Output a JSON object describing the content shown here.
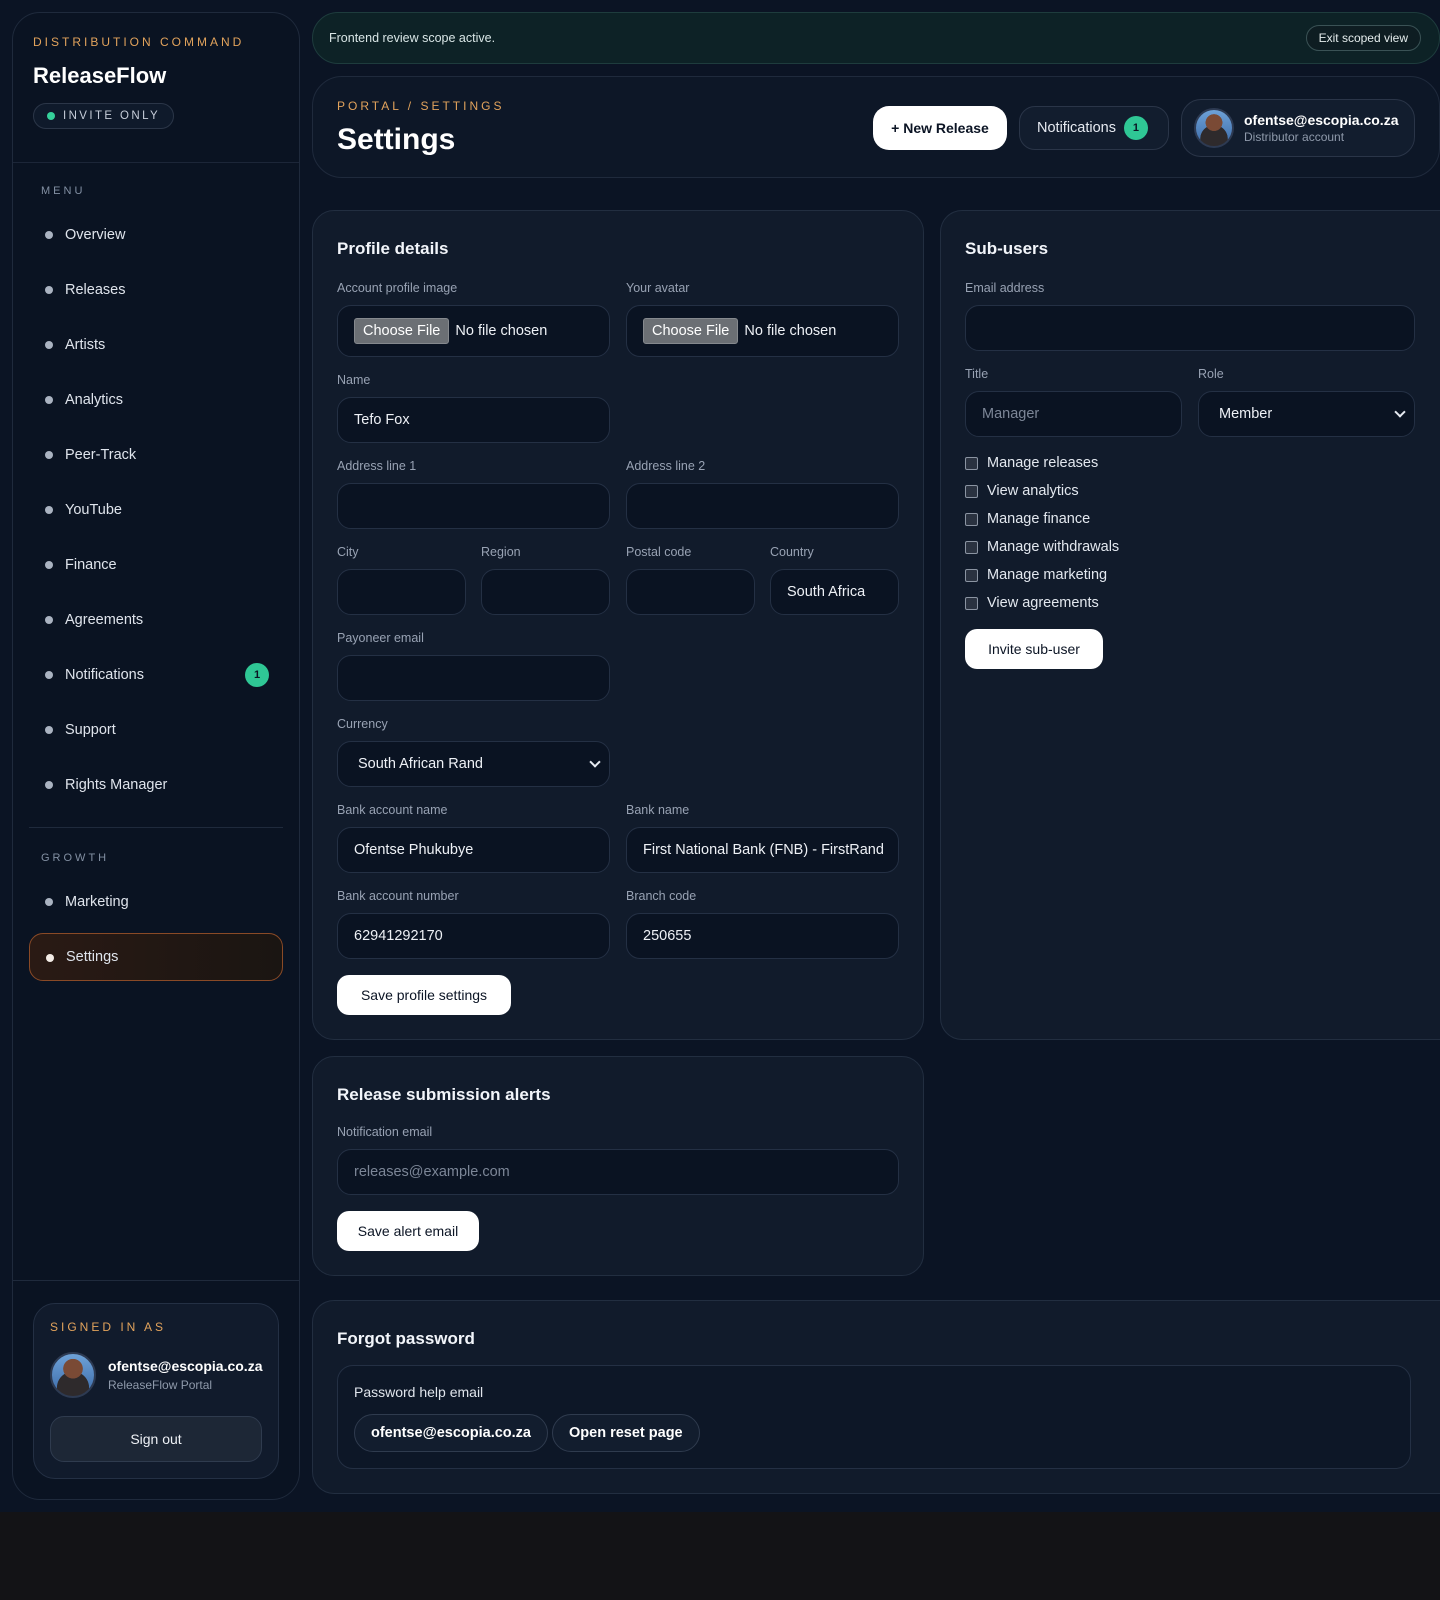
{
  "sidebar": {
    "eyebrow": "DISTRIBUTION COMMAND",
    "brand": "ReleaseFlow",
    "invite_badge": "INVITE ONLY",
    "menu_label": "MENU",
    "items": [
      {
        "label": "Overview"
      },
      {
        "label": "Releases"
      },
      {
        "label": "Artists"
      },
      {
        "label": "Analytics"
      },
      {
        "label": "Peer-Track"
      },
      {
        "label": "YouTube"
      },
      {
        "label": "Finance"
      },
      {
        "label": "Agreements"
      },
      {
        "label": "Notifications",
        "badge": "1"
      },
      {
        "label": "Support"
      },
      {
        "label": "Rights Manager"
      }
    ],
    "growth_label": "GROWTH",
    "growth_items": [
      {
        "label": "Marketing"
      },
      {
        "label": "Settings",
        "active": true
      }
    ],
    "signed_in": {
      "label": "SIGNED IN AS",
      "email": "ofentse@escopia.co.za",
      "sub": "ReleaseFlow Portal",
      "signout": "Sign out"
    }
  },
  "banner": {
    "text": "Frontend review scope active.",
    "exit": "Exit scoped view"
  },
  "header": {
    "breadcrumb": "PORTAL / SETTINGS",
    "title": "Settings",
    "new_release": "+ New Release",
    "notifications": "Notifications",
    "notifications_count": "1",
    "user_email": "ofentse@escopia.co.za",
    "user_role": "Distributor account"
  },
  "profile": {
    "title": "Profile details",
    "account_image_label": "Account profile image",
    "avatar_label": "Your avatar",
    "choose_file": "Choose File",
    "no_file": "No file chosen",
    "name_label": "Name",
    "name_value": "Tefo Fox",
    "address1_label": "Address line 1",
    "address2_label": "Address line 2",
    "city_label": "City",
    "region_label": "Region",
    "postal_label": "Postal code",
    "country_label": "Country",
    "country_value": "South Africa",
    "payoneer_label": "Payoneer email",
    "currency_label": "Currency",
    "currency_value": "South African Rand",
    "bank_account_name_label": "Bank account name",
    "bank_account_name_value": "Ofentse Phukubye",
    "bank_name_label": "Bank name",
    "bank_name_value": "First National Bank (FNB) - FirstRand",
    "bank_account_number_label": "Bank account number",
    "bank_account_number_value": "62941292170",
    "branch_code_label": "Branch code",
    "branch_code_value": "250655",
    "save": "Save profile settings"
  },
  "subusers": {
    "title": "Sub-users",
    "email_label": "Email address",
    "title_label": "Title",
    "title_placeholder": "Manager",
    "role_label": "Role",
    "role_value": "Member",
    "permissions": [
      "Manage releases",
      "View analytics",
      "Manage finance",
      "Manage withdrawals",
      "Manage marketing",
      "View agreements"
    ],
    "invite": "Invite sub-user"
  },
  "alerts": {
    "title": "Release submission alerts",
    "email_label": "Notification email",
    "email_placeholder": "releases@example.com",
    "save": "Save alert email"
  },
  "password": {
    "title": "Forgot password",
    "help_label": "Password help email",
    "email": "ofentse@escopia.co.za",
    "reset": "Open reset page"
  }
}
